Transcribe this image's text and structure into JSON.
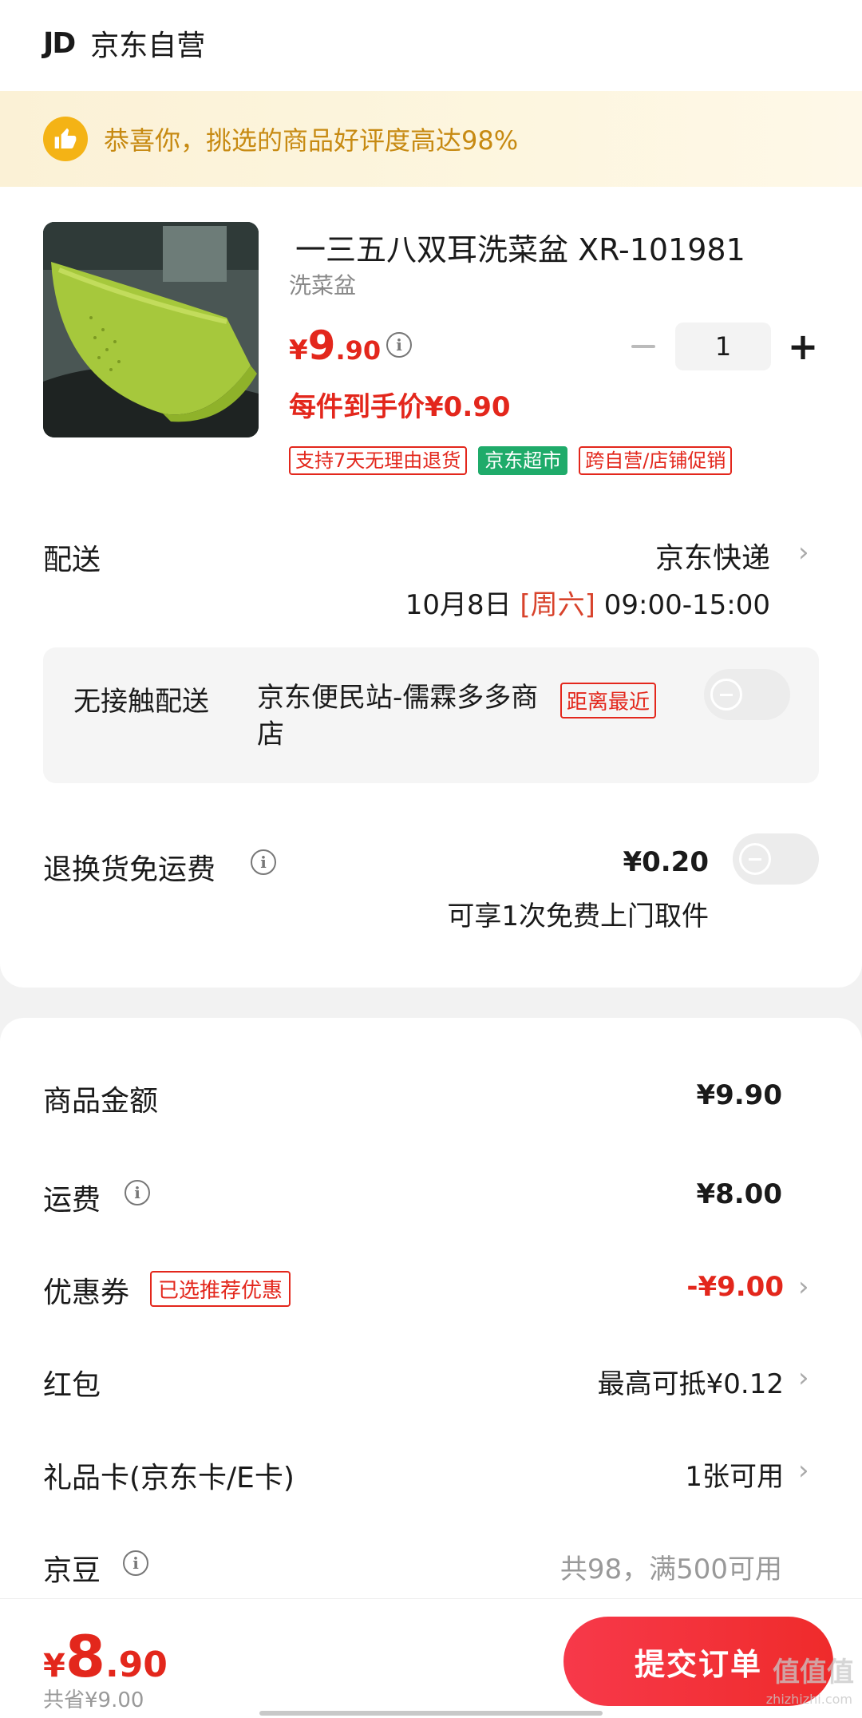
{
  "shop": {
    "logo": "JD",
    "name": "京东自营"
  },
  "banner": {
    "text": "恭喜你，挑选的商品好评度高达98%"
  },
  "product": {
    "title": "一三五八双耳洗菜盆 XR-101981",
    "subtitle": "洗菜盆",
    "price_yen": "¥",
    "price_int": "9",
    "price_dec": ".90",
    "quantity": "1",
    "unit_price": "每件到手价¥0.90",
    "tags": [
      "支持7天无理由退货",
      "京东超市",
      "跨自营/店铺促销"
    ]
  },
  "delivery": {
    "label": "配送",
    "carrier": "京东快递",
    "date": "10月8日",
    "weekday": "[周六]",
    "time": "09:00-15:00"
  },
  "contactless": {
    "label": "无接触配送",
    "station": "京东便民站-儒霖多多商店",
    "tag": "距离最近"
  },
  "return_shipping": {
    "label": "退换货免运费",
    "fee": "¥0.20",
    "note": "可享1次免费上门取件"
  },
  "summary": {
    "goods_label": "商品金额",
    "goods_value": "¥9.90",
    "shipping_label": "运费",
    "shipping_value": "¥8.00",
    "coupon_label": "优惠券",
    "coupon_tag": "已选推荐优惠",
    "coupon_value": "-¥9.00",
    "redpacket_label": "红包",
    "redpacket_value": "最高可抵¥0.12",
    "giftcard_label": "礼品卡(京东卡/E卡)",
    "giftcard_value": "1张可用",
    "jingdou_label": "京豆",
    "jingdou_value": "共98，满500可用"
  },
  "bottom": {
    "total_yen": "¥",
    "total_int": "8",
    "total_dec": ".90",
    "saved": "共省¥9.00",
    "submit": "提交订单",
    "watermark": "值值值",
    "watermark_sub": "zhizhizhi.com"
  },
  "colors": {
    "accent_red": "#e3271c",
    "green_tag": "#1fab6a",
    "banner_text": "#c78a12"
  }
}
